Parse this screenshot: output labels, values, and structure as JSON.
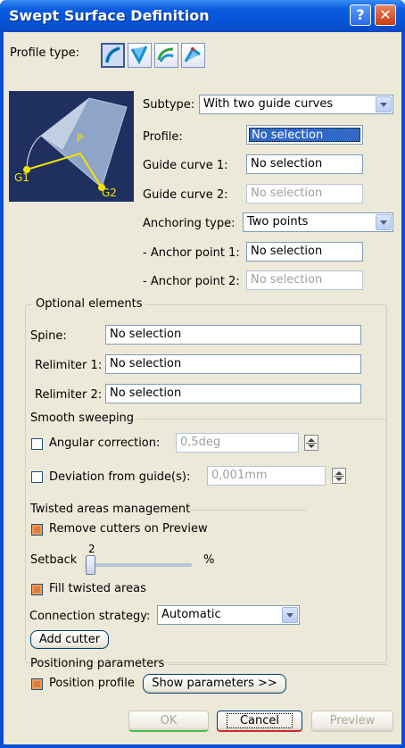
{
  "window": {
    "title": "Swept Surface Definition",
    "help_label": "?",
    "close_label": "✕"
  },
  "profile_type": {
    "label": "Profile type:",
    "icons": [
      "explicit-profile-icon",
      "line-profile-icon",
      "circle-profile-icon",
      "conic-profile-icon"
    ]
  },
  "preview_image": {
    "label_p": "P",
    "label_g1": "G1",
    "label_g2": "G2"
  },
  "subtype": {
    "label": "Subtype:",
    "value": "With two guide curves"
  },
  "profile": {
    "label": "Profile:",
    "value": "No selection"
  },
  "guide1": {
    "label": "Guide curve 1:",
    "value": "No selection"
  },
  "guide2": {
    "label": "Guide curve 2:",
    "value": "No selection"
  },
  "anchoring": {
    "label": "Anchoring type:",
    "value": "Two points"
  },
  "anchor1": {
    "label": "- Anchor point 1:",
    "value": "No selection"
  },
  "anchor2": {
    "label": "- Anchor point 2:",
    "value": "No selection"
  },
  "optional": {
    "title": "Optional elements",
    "spine_label": "Spine:",
    "spine_value": "No selection",
    "relimiter1_label": "Relimiter 1:",
    "relimiter1_value": "No selection",
    "relimiter2_label": "Relimiter 2:",
    "relimiter2_value": "No selection"
  },
  "smooth": {
    "title": "Smooth sweeping",
    "angular_label": "Angular correction:",
    "angular_value": "0,5deg",
    "deviation_label": "Deviation from guide(s):",
    "deviation_value": "0,001mm"
  },
  "twisted": {
    "title": "Twisted areas management",
    "remove_cutters_label": "Remove cutters on Preview",
    "setback_label": "Setback",
    "setback_value": "2",
    "setback_unit": "%",
    "fill_label": "Fill twisted areas",
    "connection_label": "Connection strategy:",
    "connection_value": "Automatic",
    "add_cutter_label": "Add cutter"
  },
  "positioning": {
    "title": "Positioning parameters",
    "position_profile_label": "Position profile",
    "show_parameters_label": "Show parameters >>"
  },
  "footer": {
    "ok_label": "OK",
    "cancel_label": "Cancel",
    "preview_label": "Preview"
  }
}
